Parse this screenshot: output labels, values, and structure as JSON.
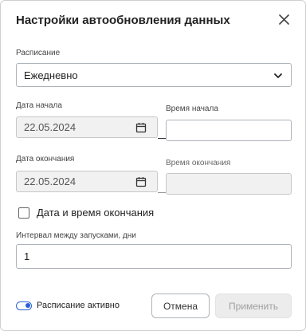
{
  "dialog": {
    "title": "Настройки автообновления данных",
    "close_icon": "close-icon"
  },
  "schedule": {
    "label": "Расписание",
    "value": "Ежедневно",
    "icon": "chevron-down-icon"
  },
  "start_date": {
    "label": "Дата начала",
    "value": "22.05.2024",
    "icon": "calendar-icon"
  },
  "start_time": {
    "label": "Время начала",
    "value": ""
  },
  "end_date": {
    "label": "Дата окончания",
    "value": "22.05.2024",
    "icon": "calendar-icon"
  },
  "end_time": {
    "label": "Время окончания",
    "value": ""
  },
  "end_checkbox": {
    "label": "Дата и время окончания",
    "checked": false
  },
  "interval": {
    "label": "Интервал между запусками, дни",
    "value": "1"
  },
  "footer": {
    "toggle_label": "Расписание активно",
    "toggle_on": true,
    "cancel_label": "Отмена",
    "apply_label": "Применить"
  },
  "colors": {
    "accent": "#2a5fd6",
    "disabled_bg": "#f1f1f1",
    "border": "#aeb3b9"
  }
}
